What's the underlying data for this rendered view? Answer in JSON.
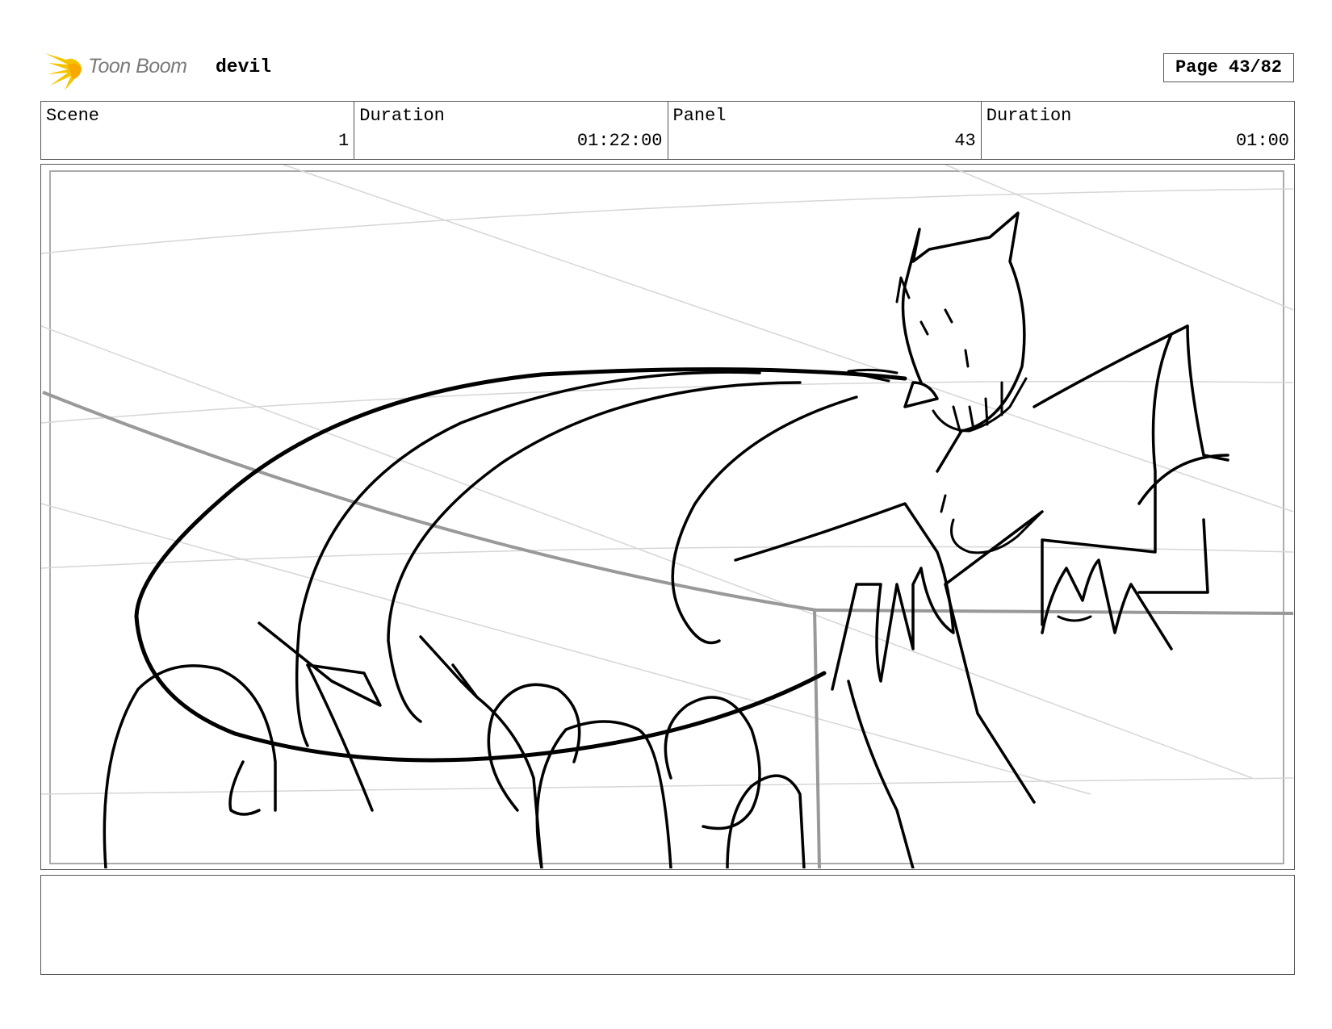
{
  "header": {
    "brand": "Toon Boom",
    "project_title": "devil",
    "page_label": "Page 43/82"
  },
  "info": {
    "scene_label": "Scene",
    "scene_value": "1",
    "scene_duration_label": "Duration",
    "scene_duration_value": "01:22:00",
    "panel_label": "Panel",
    "panel_value": "43",
    "panel_duration_label": "Duration",
    "panel_duration_value": "01:00"
  },
  "notes": {
    "text": ""
  },
  "colors": {
    "logo_accent": "#f5c400",
    "border": "#555555"
  },
  "icons": {
    "logo": "toon-boom-burst-icon"
  }
}
